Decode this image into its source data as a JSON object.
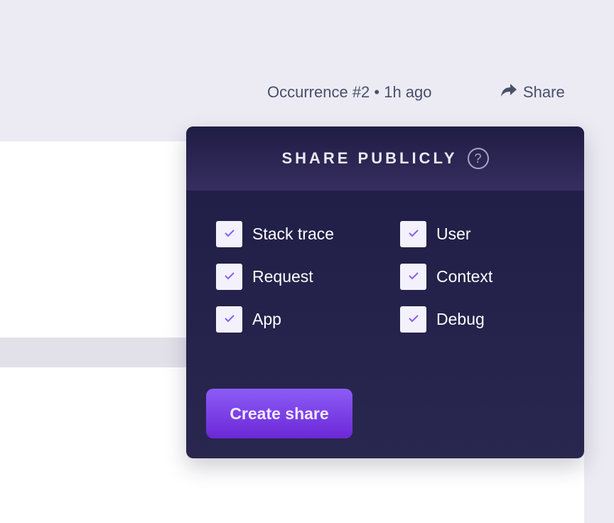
{
  "header": {
    "occurrence": "Occurrence #2 • 1h ago",
    "share_label": "Share"
  },
  "popup": {
    "title": "SHARE PUBLICLY",
    "help_glyph": "?",
    "options": [
      {
        "label": "Stack trace",
        "checked": true
      },
      {
        "label": "User",
        "checked": true
      },
      {
        "label": "Request",
        "checked": true
      },
      {
        "label": "Context",
        "checked": true
      },
      {
        "label": "App",
        "checked": true
      },
      {
        "label": "Debug",
        "checked": true
      }
    ],
    "create_label": "Create share"
  },
  "colors": {
    "accent": "#7c3aed",
    "popup_bg": "#1f1d45",
    "check": "#8b5cf6"
  }
}
